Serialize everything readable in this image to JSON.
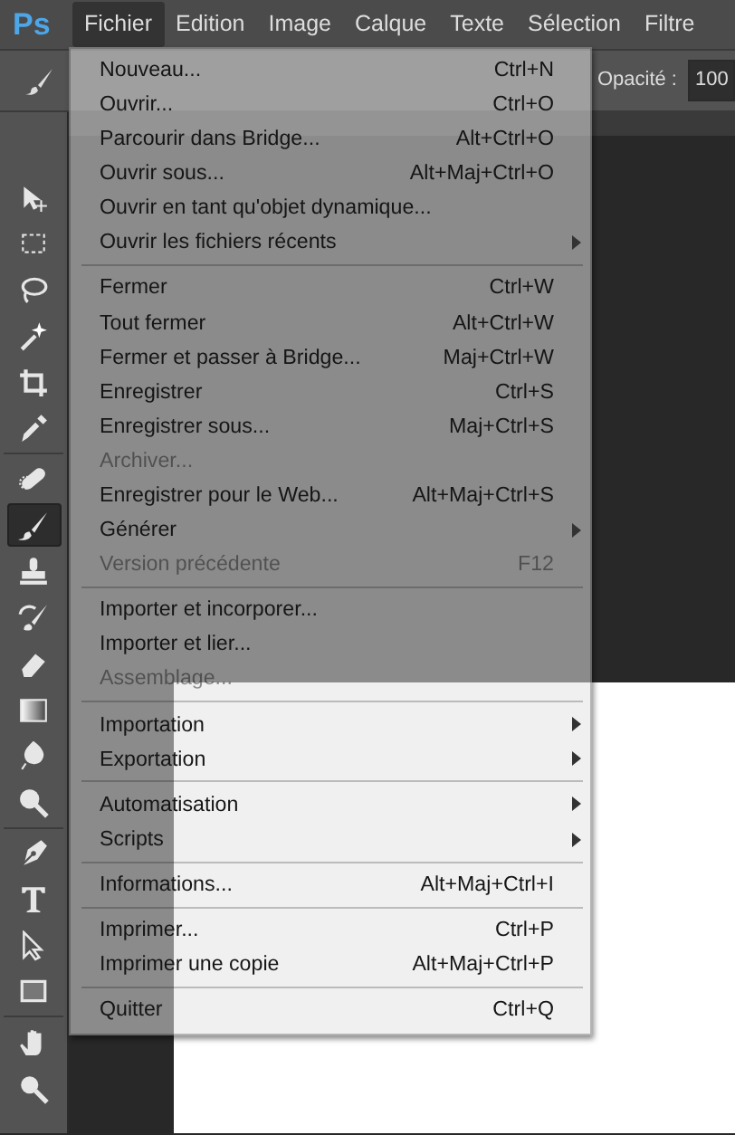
{
  "app_logo": "Ps",
  "menubar": [
    {
      "label": "Fichier",
      "selected": true
    },
    {
      "label": "Edition",
      "selected": false
    },
    {
      "label": "Image",
      "selected": false
    },
    {
      "label": "Calque",
      "selected": false
    },
    {
      "label": "Texte",
      "selected": false
    },
    {
      "label": "Sélection",
      "selected": false
    },
    {
      "label": "Filtre",
      "selected": false
    }
  ],
  "options_bar": {
    "opacity_label": "Opacité :",
    "opacity_value": "100"
  },
  "tools": [
    {
      "kind": "move",
      "selected": false
    },
    {
      "kind": "marquee",
      "selected": false
    },
    {
      "kind": "lasso",
      "selected": false
    },
    {
      "kind": "wand",
      "selected": false
    },
    {
      "kind": "crop",
      "selected": false
    },
    {
      "kind": "eyedropper",
      "selected": false
    },
    {
      "kind": "separator"
    },
    {
      "kind": "bandage",
      "selected": false
    },
    {
      "kind": "brush",
      "selected": true
    },
    {
      "kind": "stamp",
      "selected": false
    },
    {
      "kind": "history",
      "selected": false
    },
    {
      "kind": "eraser",
      "selected": false
    },
    {
      "kind": "gradient",
      "selected": false
    },
    {
      "kind": "drop",
      "selected": false
    },
    {
      "kind": "dodge",
      "selected": false
    },
    {
      "kind": "separator"
    },
    {
      "kind": "pen",
      "selected": false
    },
    {
      "kind": "type",
      "selected": false
    },
    {
      "kind": "arrow",
      "selected": false
    },
    {
      "kind": "rectangle",
      "selected": false
    },
    {
      "kind": "separator"
    },
    {
      "kind": "hand",
      "selected": false
    },
    {
      "kind": "zoom",
      "selected": false
    }
  ],
  "file_menu": [
    {
      "kind": "item",
      "label": "Nouveau...",
      "shortcut": "Ctrl+N",
      "disabled": false
    },
    {
      "kind": "item",
      "label": "Ouvrir...",
      "shortcut": "Ctrl+O",
      "disabled": false
    },
    {
      "kind": "item",
      "label": "Parcourir dans Bridge...",
      "shortcut": "Alt+Ctrl+O",
      "disabled": false
    },
    {
      "kind": "item",
      "label": "Ouvrir sous...",
      "shortcut": "Alt+Maj+Ctrl+O",
      "disabled": false
    },
    {
      "kind": "item",
      "label": "Ouvrir en tant qu'objet dynamique...",
      "disabled": false
    },
    {
      "kind": "item",
      "label": "Ouvrir les fichiers récents",
      "submenu": true,
      "disabled": false
    },
    {
      "kind": "separator"
    },
    {
      "kind": "item",
      "label": "Fermer",
      "shortcut": "Ctrl+W",
      "disabled": false
    },
    {
      "kind": "item",
      "label": "Tout fermer",
      "shortcut": "Alt+Ctrl+W",
      "disabled": false
    },
    {
      "kind": "item",
      "label": "Fermer et passer à Bridge...",
      "shortcut": "Maj+Ctrl+W",
      "disabled": false
    },
    {
      "kind": "item",
      "label": "Enregistrer",
      "shortcut": "Ctrl+S",
      "disabled": false
    },
    {
      "kind": "item",
      "label": "Enregistrer sous...",
      "shortcut": "Maj+Ctrl+S",
      "disabled": false
    },
    {
      "kind": "item",
      "label": "Archiver...",
      "disabled": true
    },
    {
      "kind": "item",
      "label": "Enregistrer pour le Web...",
      "shortcut": "Alt+Maj+Ctrl+S",
      "disabled": false
    },
    {
      "kind": "item",
      "label": "Générer",
      "submenu": true,
      "disabled": false
    },
    {
      "kind": "item",
      "label": "Version précédente",
      "shortcut": "F12",
      "disabled": true
    },
    {
      "kind": "separator"
    },
    {
      "kind": "item",
      "label": "Importer et incorporer...",
      "disabled": false
    },
    {
      "kind": "item",
      "label": "Importer et lier...",
      "disabled": false
    },
    {
      "kind": "item",
      "label": "Assemblage...",
      "disabled": true
    },
    {
      "kind": "separator"
    },
    {
      "kind": "item",
      "label": "Importation",
      "submenu": true,
      "disabled": false
    },
    {
      "kind": "item",
      "label": "Exportation",
      "submenu": true,
      "disabled": false
    },
    {
      "kind": "separator"
    },
    {
      "kind": "item",
      "label": "Automatisation",
      "submenu": true,
      "disabled": false
    },
    {
      "kind": "item",
      "label": "Scripts",
      "submenu": true,
      "disabled": false
    },
    {
      "kind": "separator"
    },
    {
      "kind": "item",
      "label": "Informations...",
      "shortcut": "Alt+Maj+Ctrl+I",
      "disabled": false
    },
    {
      "kind": "separator"
    },
    {
      "kind": "item",
      "label": "Imprimer...",
      "shortcut": "Ctrl+P",
      "disabled": false
    },
    {
      "kind": "item",
      "label": "Imprimer une copie",
      "shortcut": "Alt+Maj+Ctrl+P",
      "disabled": false
    },
    {
      "kind": "separator"
    },
    {
      "kind": "item",
      "label": "Quitter",
      "shortcut": "Ctrl+Q",
      "disabled": false
    }
  ]
}
